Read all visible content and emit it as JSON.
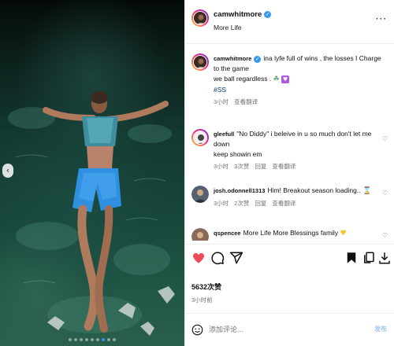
{
  "post": {
    "username": "camwhitmore",
    "subtitle": "More Life"
  },
  "caption": {
    "username": "camwhitmore",
    "text_line1": "ina lyfe full of wins , the losses I Charge to the game",
    "text_line2": "we ball regardless .",
    "hashtag": "#SS",
    "time": "3小时",
    "translate": "查看翻译"
  },
  "comments": [
    {
      "username": "gleefull",
      "text_line1": "\"No Diddy\" i beleive in u so much don't let me down",
      "text_line2": "keep showin em",
      "time": "3小时",
      "likes": "3次赞",
      "reply": "回复",
      "translate": "查看翻译"
    },
    {
      "username": "josh.odonnell1313",
      "text_line1": "Him! Breakout season loading..",
      "time": "3小时",
      "likes": "2次赞",
      "reply": "回复",
      "translate": "查看翻译"
    },
    {
      "username": "qspencee",
      "text_line1": "More Life More Blessings family"
    }
  ],
  "stats": {
    "likes": "5632次赞",
    "time": "3小时前"
  },
  "composer": {
    "placeholder": "添加评论...",
    "post_label": "发布"
  },
  "colors": {
    "like_red": "#ed4956",
    "verified_blue": "#3897f0",
    "link_blue": "#00376b",
    "carousel_active": "#3b8df5"
  },
  "icons": [
    "chevron-left-icon",
    "more-icon",
    "verified-icon",
    "heart-icon",
    "comment-icon",
    "share-icon",
    "save-icon",
    "copy-icon",
    "download-icon",
    "smile-icon"
  ],
  "carousel": {
    "total": 9,
    "active": 6
  }
}
